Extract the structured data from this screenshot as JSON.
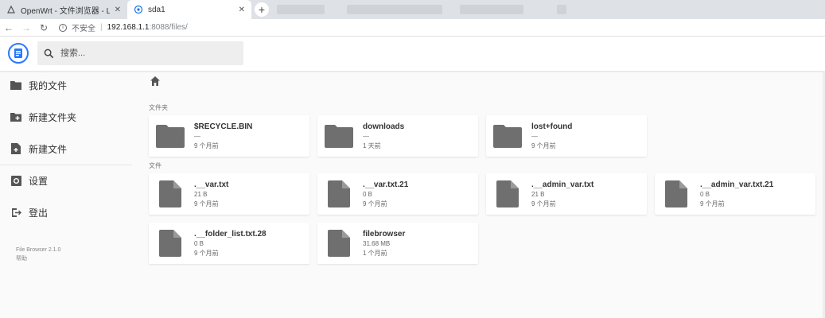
{
  "browser": {
    "tabs": [
      {
        "title": "OpenWrt - 文件浏览器 - LuCI",
        "close": "✕"
      },
      {
        "title": "sda1",
        "close": "✕"
      }
    ],
    "new_tab": "+",
    "insecure_label": "不安全",
    "url_host": "192.168.1.1",
    "url_rest": ":8088/files/"
  },
  "header": {
    "search_placeholder": "搜索..."
  },
  "sidebar": {
    "items": [
      {
        "label": "我的文件",
        "icon": "folder-icon"
      },
      {
        "label": "新建文件夹",
        "icon": "create-folder-icon"
      },
      {
        "label": "新建文件",
        "icon": "note-add-icon"
      },
      {
        "label": "设置",
        "icon": "settings-icon"
      },
      {
        "label": "登出",
        "icon": "logout-icon"
      }
    ],
    "version": "File Browser 2.1.0",
    "help": "帮助"
  },
  "main": {
    "folders_label": "文件夹",
    "files_label": "文件",
    "folders": [
      {
        "name": "$RECYCLE.BIN",
        "size": "—",
        "modified": "9 个月前"
      },
      {
        "name": "downloads",
        "size": "—",
        "modified": "1 天前"
      },
      {
        "name": "lost+found",
        "size": "—",
        "modified": "9 个月前"
      }
    ],
    "files": [
      {
        "name": ".__var.txt",
        "size": "21 B",
        "modified": "9 个月前"
      },
      {
        "name": ".__var.txt.21",
        "size": "0 B",
        "modified": "9 个月前"
      },
      {
        "name": ".__admin_var.txt",
        "size": "21 B",
        "modified": "9 个月前"
      },
      {
        "name": ".__admin_var.txt.21",
        "size": "0 B",
        "modified": "9 个月前"
      },
      {
        "name": ".__folder_list.txt.28",
        "size": "0 B",
        "modified": "9 个月前"
      },
      {
        "name": "filebrowser",
        "size": "31.68 MB",
        "modified": "1 个月前"
      }
    ]
  },
  "colors": {
    "accent": "#2979ff",
    "icon_gray": "#6f6f6f"
  }
}
